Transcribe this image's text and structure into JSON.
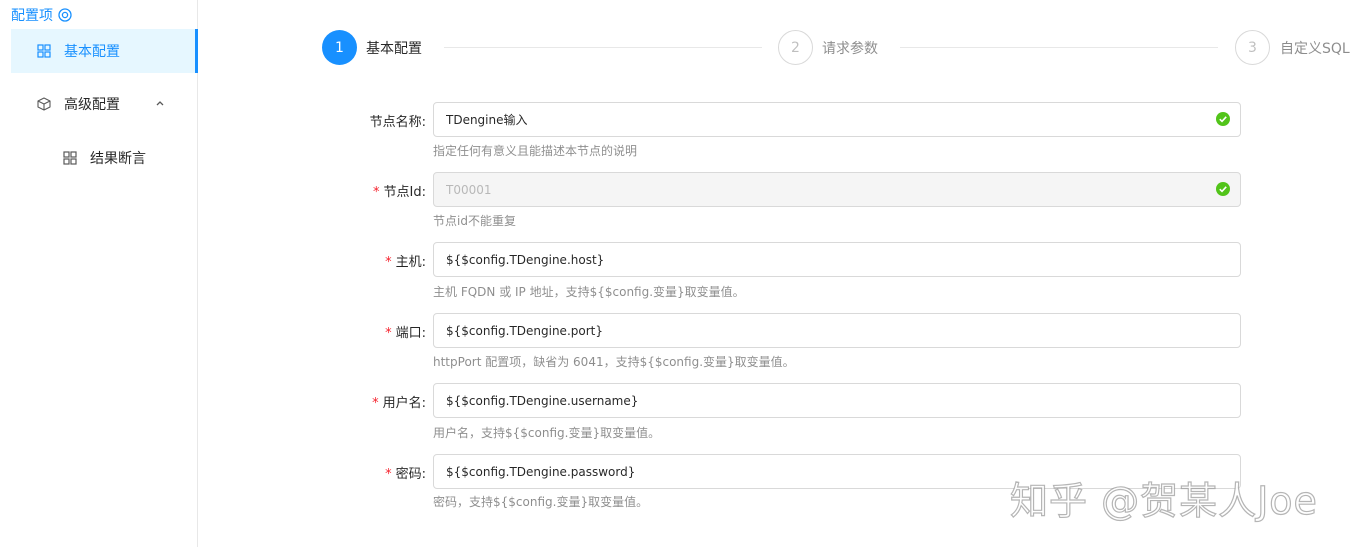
{
  "sidebar": {
    "title": "配置项",
    "title_icon": "settings-circle-icon",
    "items": [
      {
        "label": "基本配置",
        "icon": "grid-icon",
        "active": true
      },
      {
        "label": "高级配置",
        "icon": "cube-icon",
        "expanded": true
      },
      {
        "label": "结果断言",
        "icon": "grid-icon"
      }
    ]
  },
  "steps": [
    {
      "number": "1",
      "label": "基本配置",
      "status": "active"
    },
    {
      "number": "2",
      "label": "请求参数",
      "status": "wait"
    },
    {
      "number": "3",
      "label": "自定义SQL",
      "status": "wait"
    }
  ],
  "form": {
    "fields": [
      {
        "label": "节点名称:",
        "required": false,
        "value": "TDengine输入",
        "help": "指定任何有意义且能描述本节点的说明",
        "valid": true,
        "disabled": false
      },
      {
        "label": "节点Id:",
        "required": true,
        "value": "T00001",
        "help": "节点id不能重复",
        "valid": true,
        "disabled": true
      },
      {
        "label": "主机:",
        "required": true,
        "value": "${$config.TDengine.host}",
        "help": "主机 FQDN 或 IP 地址，支持${$config.变量}取变量值。",
        "valid": false,
        "disabled": false
      },
      {
        "label": "端口:",
        "required": true,
        "value": "${$config.TDengine.port}",
        "help": "httpPort 配置项，缺省为 6041，支持${$config.变量}取变量值。",
        "valid": false,
        "disabled": false
      },
      {
        "label": "用户名:",
        "required": true,
        "value": "${$config.TDengine.username}",
        "help": "用户名，支持${$config.变量}取变量值。",
        "valid": false,
        "disabled": false
      },
      {
        "label": "密码:",
        "required": true,
        "value": "${$config.TDengine.password}",
        "help": "密码，支持${$config.变量}取变量值。",
        "valid": false,
        "disabled": false
      }
    ]
  },
  "colors": {
    "primary": "#1890ff",
    "success": "#52c41a",
    "required": "#f5222d"
  },
  "watermark": "知乎 @贺某人Joe"
}
